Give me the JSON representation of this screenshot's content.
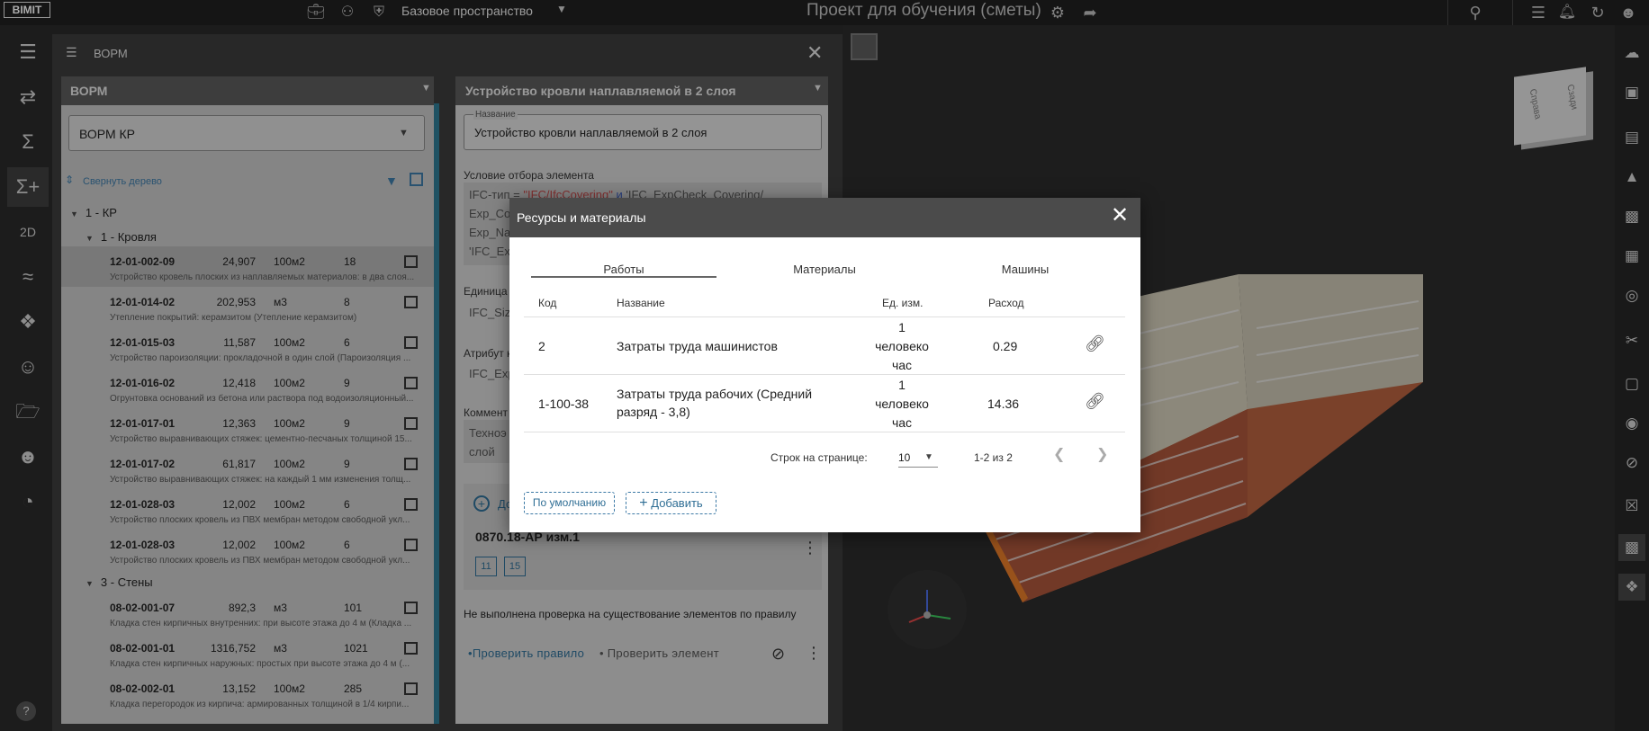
{
  "app": {
    "logo": "BIMIT",
    "space_label": "Базовое пространство",
    "project_title": "Проект для обучения (сметы)"
  },
  "panel": {
    "title": "ВОРМ",
    "left_column": {
      "header": "ВОРМ",
      "select_value": "ВОРМ КР",
      "collapse_label": "Свернуть дерево",
      "tree": {
        "group1": "1 - КР",
        "group1_sub": "1 - Кровля",
        "group2_sub": "3 - Стены"
      },
      "rows_roof": [
        {
          "code": "12-01-002-09",
          "qty": "24,907",
          "unit": "100м2",
          "count": "18",
          "desc": "Устройство кровель плоских из наплавляемых материалов: в два слоя..."
        },
        {
          "code": "12-01-014-02",
          "qty": "202,953",
          "unit": "м3",
          "count": "8",
          "desc": "Утепление покрытий: керамзитом (Утепление керамзитом)"
        },
        {
          "code": "12-01-015-03",
          "qty": "11,587",
          "unit": "100м2",
          "count": "6",
          "desc": "Устройство пароизоляции: прокладочной в один слой (Пароизоляция ..."
        },
        {
          "code": "12-01-016-02",
          "qty": "12,418",
          "unit": "100м2",
          "count": "9",
          "desc": "Огрунтовка оснований из бетона или раствора под водоизоляционный..."
        },
        {
          "code": "12-01-017-01",
          "qty": "12,363",
          "unit": "100м2",
          "count": "9",
          "desc": "Устройство выравнивающих стяжек: цементно-песчаных толщиной 15..."
        },
        {
          "code": "12-01-017-02",
          "qty": "61,817",
          "unit": "100м2",
          "count": "9",
          "desc": "Устройство выравнивающих стяжек: на каждый 1 мм изменения толщ..."
        },
        {
          "code": "12-01-028-03",
          "qty": "12,002",
          "unit": "100м2",
          "count": "6",
          "desc": "Устройство плоских кровель из ПВХ мембран методом свободной укл..."
        },
        {
          "code": "12-01-028-03",
          "qty": "12,002",
          "unit": "100м2",
          "count": "6",
          "desc": "Устройство плоских кровель из ПВХ мембран методом свободной укл..."
        }
      ],
      "rows_walls": [
        {
          "code": "08-02-001-07",
          "qty": "892,3",
          "unit": "м3",
          "count": "101",
          "desc": "Кладка стен кирпичных внутренних: при высоте этажа до 4 м (Кладка ..."
        },
        {
          "code": "08-02-001-01",
          "qty": "1316,752",
          "unit": "м3",
          "count": "1021",
          "desc": "Кладка стен кирпичных наружных: простых при высоте этажа до 4 м (..."
        },
        {
          "code": "08-02-002-01",
          "qty": "13,152",
          "unit": "100м2",
          "count": "285",
          "desc": "Кладка перегородок из кирпича: армированных толщиной в 1/4 кирпи..."
        }
      ]
    },
    "right_column": {
      "header": "Устройство кровли наплавляемой в 2 слоя",
      "name_label": "Название",
      "name_value": "Устройство кровли наплавляемой в  2 слоя",
      "condition_label": "Условие отбора элемента",
      "condition_line1_a": "IFC-тип = ",
      "condition_line1_b": "\"IFC/IfcCovering\"",
      "condition_line1_c": " и ",
      "condition_line1_d": "'IFC_ExpCheck_Covering/",
      "condition_line2": "Exp_Co",
      "condition_line3": "Exp_Na",
      "condition_line4": "'IFC_Ex",
      "unit_label": "Единица",
      "unit_value": "IFC_Siz",
      "attr_label": "Атрибут к",
      "attr_value": "IFC_Exp",
      "comment_label": "Коммент",
      "comment_value_1": "Техноэ",
      "comment_value_2": "слой",
      "add_label": "До",
      "doc_name": "0870.18-АР изм.1",
      "doc_chips": [
        "11",
        "15"
      ],
      "check_message": "Не выполнена проверка на существование элементов по правилу",
      "check_rule": "Проверить правило",
      "check_element": "Проверить элемент"
    }
  },
  "viewport": {
    "cube_front": "Справа",
    "cube_right": "Сзади"
  },
  "modal": {
    "title": "Ресурсы и материалы",
    "tabs": [
      "Работы",
      "Материалы",
      "Машины"
    ],
    "active_tab": "Работы",
    "columns": {
      "code": "Код",
      "name": "Название",
      "unit": "Ед. изм.",
      "rate": "Расход"
    },
    "rows": [
      {
        "code": "2",
        "name": "Затраты труда машинистов",
        "unit_1": "1",
        "unit_2": "человеко",
        "unit_3": "час",
        "rate": "0.29"
      },
      {
        "code": "1-100-38",
        "name_1": "Затраты труда рабочих (Средний",
        "name_2": "разряд - 3,8)",
        "unit_1": "1",
        "unit_2": "человеко",
        "unit_3": "час",
        "rate": "14.36"
      }
    ],
    "pager": {
      "label": "Строк на странице:",
      "per_page": "10",
      "range": "1-2 из 2"
    },
    "btn_default": "По умолчанию",
    "btn_add": "Добавить"
  },
  "colors": {
    "accent": "#2f6e95",
    "modal_header": "#4b4b4b",
    "brick": "#b4603f"
  }
}
